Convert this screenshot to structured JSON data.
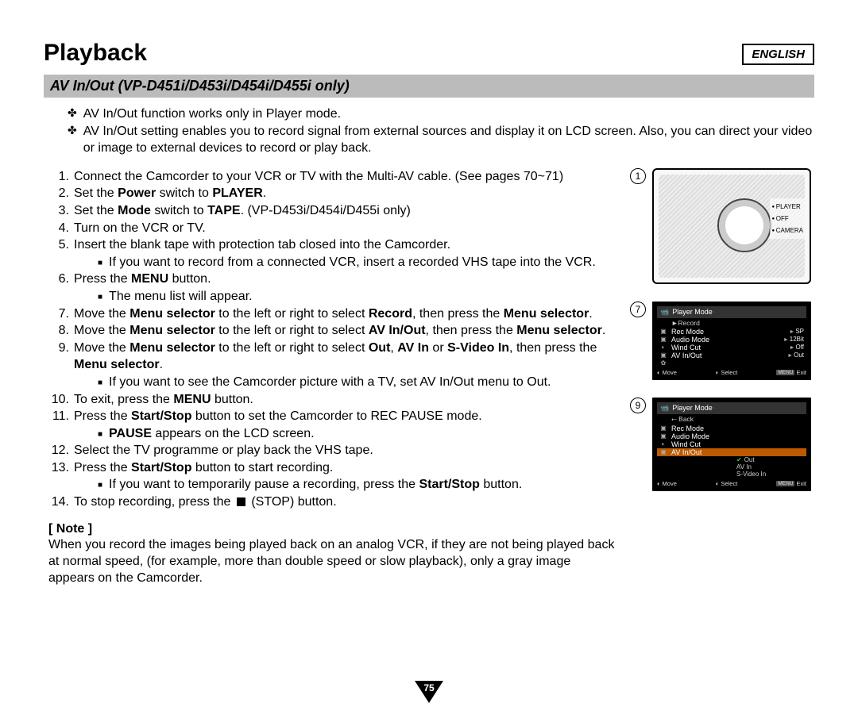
{
  "lang_tag": "ENGLISH",
  "title": "Playback",
  "subtitle": "AV In/Out (VP-D451i/D453i/D454i/D455i only)",
  "intro": [
    "AV In/Out function works only in Player mode.",
    "AV In/Out setting enables you to record signal from external sources and display it on LCD screen. Also, you can direct your video or image to external devices to record or play back."
  ],
  "steps": {
    "s1": {
      "n": "1.",
      "t": "Connect the Camcorder to your VCR or TV with the Multi-AV cable. (See pages 70~71)"
    },
    "s2": {
      "n": "2.",
      "pre": "Set the ",
      "b1": "Power",
      "mid": " switch to ",
      "b2": "PLAYER",
      "post": "."
    },
    "s3": {
      "n": "3.",
      "pre": "Set the ",
      "b1": "Mode",
      "mid": " switch to ",
      "b2": "TAPE",
      "post": ". (VP-D453i/D454i/D455i only)"
    },
    "s4": {
      "n": "4.",
      "t": "Turn on the VCR or TV."
    },
    "s5": {
      "n": "5.",
      "t": "Insert the blank tape with protection tab closed into the Camcorder.",
      "sub": "If you want to record from a connected VCR, insert a recorded VHS tape into the VCR."
    },
    "s6": {
      "n": "6.",
      "pre": "Press the ",
      "b1": "MENU",
      "post": " button.",
      "sub": "The menu list will appear."
    },
    "s7": {
      "n": "7.",
      "pre": "Move the ",
      "b1": "Menu selector",
      "mid": " to the left or right to select ",
      "b2": "Record",
      "mid2": ", then press the ",
      "b3": "Menu selector",
      "post": "."
    },
    "s8": {
      "n": "8.",
      "pre": "Move the ",
      "b1": "Menu selector",
      "mid": " to the left or right to select ",
      "b2": "AV In/Out",
      "mid2": ", then press the ",
      "b3": "Menu selector",
      "post": "."
    },
    "s9": {
      "n": "9.",
      "pre": "Move the ",
      "b1": "Menu selector",
      "mid": " to the left or right to select ",
      "b2": "Out",
      "c1": ", ",
      "b3": "AV In",
      "c2": " or ",
      "b4": "S-Video In",
      "mid2": ", then press the ",
      "b5": "Menu selector",
      "post": ".",
      "sub": "If you want to see the Camcorder picture with a TV, set AV In/Out menu to Out."
    },
    "s10": {
      "n": "10.",
      "pre": "To exit, press the ",
      "b1": "MENU",
      "post": " button."
    },
    "s11": {
      "n": "11.",
      "pre": "Press the ",
      "b1": "Start/Stop",
      "post": " button to set the Camcorder to REC PAUSE mode.",
      "sub_b": "PAUSE",
      "sub_post": " appears on the LCD screen."
    },
    "s12": {
      "n": "12.",
      "t": "Select the TV programme or play back the VHS tape."
    },
    "s13": {
      "n": "13.",
      "pre": "Press the ",
      "b1": "Start/Stop",
      "post": " button to start recording.",
      "sub_pre": "If you want to temporarily pause a recording, press the ",
      "sub_b": "Start/Stop",
      "sub_post": " button."
    },
    "s14": {
      "n": "14.",
      "pre": "To stop recording, press the ",
      "post": " (STOP) button."
    }
  },
  "note": {
    "head": "[ Note ]",
    "body": "When you record the images being played back on an analog VCR, if they are not being played back at normal speed, (for example, more than double speed or slow playback), only a gray image appears on the Camcorder."
  },
  "fig1": {
    "num": "1",
    "labels": [
      "PLAYER",
      "OFF",
      "CAMERA"
    ]
  },
  "fig7": {
    "num": "7",
    "title": "Player Mode",
    "sub": "►Record",
    "rows": [
      {
        "lbl": "Rec Mode",
        "val": "SP"
      },
      {
        "lbl": "Audio Mode",
        "val": "12Bit"
      },
      {
        "lbl": "Wind Cut",
        "val": "Off"
      },
      {
        "lbl": "AV In/Out",
        "val": "Out"
      }
    ],
    "foot": {
      "move": "Move",
      "select": "Select",
      "exit": "Exit",
      "menu": "MENU"
    }
  },
  "fig9": {
    "num": "9",
    "title": "Player Mode",
    "sub": "⭠ Back",
    "rows": [
      {
        "lbl": "Rec Mode"
      },
      {
        "lbl": "Audio Mode"
      },
      {
        "lbl": "Wind Cut"
      }
    ],
    "hl": "AV In/Out",
    "opts": [
      "Out",
      "AV In",
      "S-Video In"
    ],
    "foot": {
      "move": "Move",
      "select": "Select",
      "exit": "Exit",
      "menu": "MENU"
    }
  },
  "page_number": "75"
}
